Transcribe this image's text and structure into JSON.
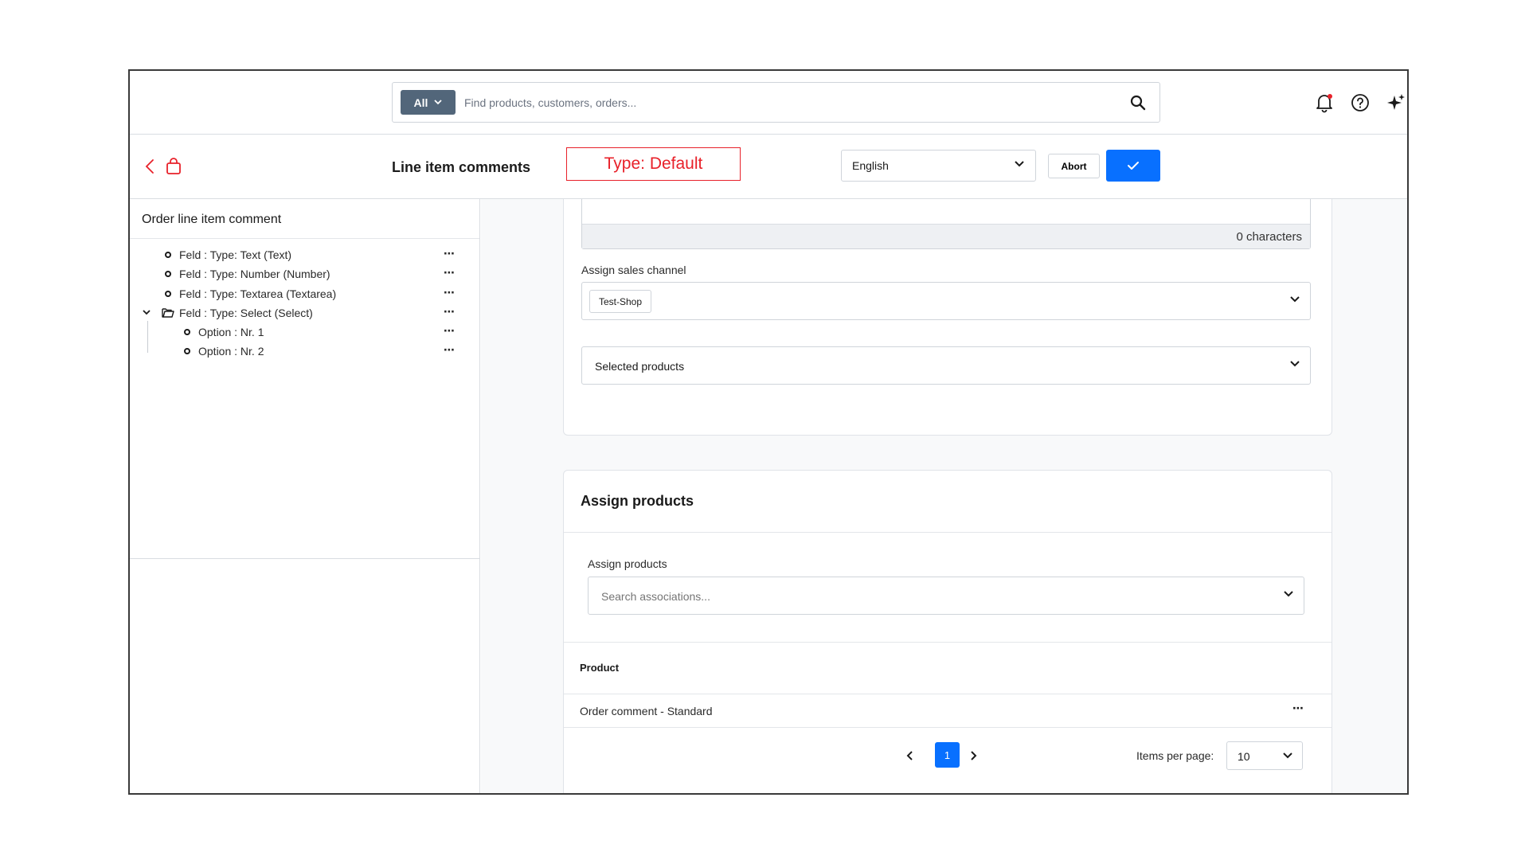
{
  "search": {
    "scope_label": "All",
    "placeholder": "Find products, customers, orders..."
  },
  "header": {
    "title": "Line item comments",
    "type_badge": "Type: Default",
    "language": "English",
    "abort_label": "Abort"
  },
  "sidebar": {
    "title": "Order line item comment",
    "items": [
      {
        "label": "Feld : Type: Text (Text)"
      },
      {
        "label": "Feld : Type: Number (Number)"
      },
      {
        "label": "Feld : Type: Textarea (Textarea)"
      },
      {
        "label": "Feld : Type: Select (Select)"
      },
      {
        "label": "Option : Nr. 1"
      },
      {
        "label": "Option : Nr. 2"
      }
    ]
  },
  "card1": {
    "char_count": "0 characters",
    "sales_channel_label": "Assign sales channel",
    "sales_channel_tag": "Test-Shop",
    "selected_products": "Selected products"
  },
  "card2": {
    "title": "Assign products",
    "field_label": "Assign products",
    "search_placeholder": "Search associations...",
    "column_product": "Product",
    "rows": [
      {
        "product": "Order comment - Standard"
      }
    ],
    "pagination": {
      "current_page": "1",
      "items_per_page_label": "Items per page:",
      "items_per_page": "10"
    }
  },
  "colors": {
    "primary": "#0870ff",
    "badge": "#e8212a",
    "scope": "#52667a",
    "notification_dot": "#e8212a"
  }
}
